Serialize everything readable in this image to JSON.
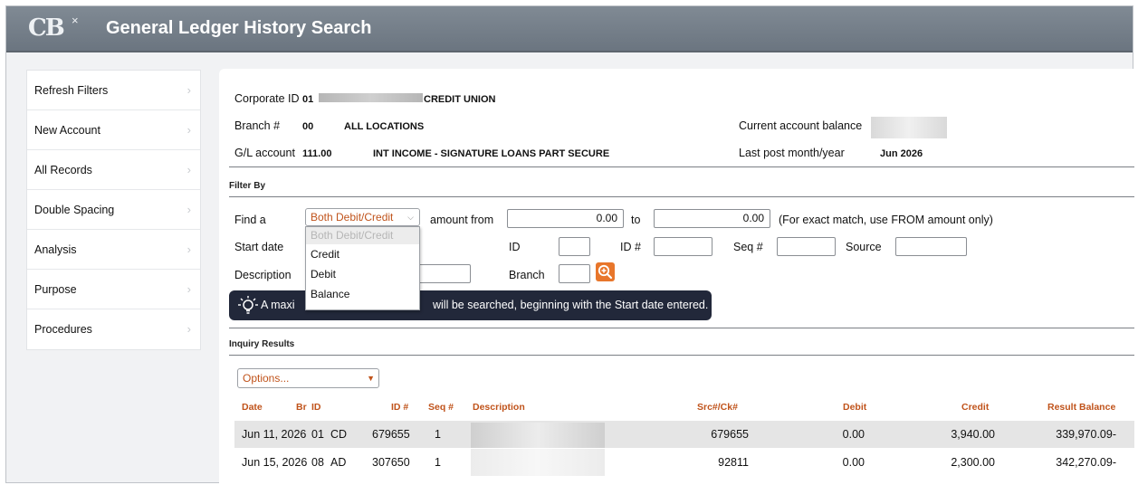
{
  "app": {
    "title": "General Ledger History Search",
    "logo_text": "CB",
    "logo_mark": "×"
  },
  "sidebar": {
    "items": [
      {
        "label": "Refresh Filters"
      },
      {
        "label": "New Account"
      },
      {
        "label": "All Records"
      },
      {
        "label": "Double Spacing"
      },
      {
        "label": "Analysis"
      },
      {
        "label": "Purpose"
      },
      {
        "label": "Procedures"
      }
    ]
  },
  "header": {
    "corporate_id_label": "Corporate ID",
    "corporate_id": "01",
    "corporate_name": "CREDIT UNION",
    "branch_label": "Branch #",
    "branch": "00",
    "branch_name": "ALL LOCATIONS",
    "gl_label": "G/L account",
    "gl_account": "111.00",
    "gl_name": "INT INCOME - SIGNATURE LOANS PART SECURE",
    "balance_label": "Current account balance",
    "last_post_label": "Last post month/year",
    "last_post": "Jun 2026"
  },
  "filter": {
    "section_label": "Filter By",
    "find_label": "Find a",
    "type_selected": "Both Debit/Credit",
    "type_options": [
      "Both Debit/Credit",
      "Credit",
      "Debit",
      "Balance"
    ],
    "amount_from_label": "amount from",
    "amount_from": "0.00",
    "to_label": "to",
    "amount_to": "0.00",
    "exact_note": "(For exact match, use FROM amount only)",
    "start_date_label": "Start date",
    "id_label": "ID",
    "id_num_label": "ID #",
    "seq_label": "Seq #",
    "source_label": "Source",
    "description_label": "Description",
    "branch_label": "Branch"
  },
  "tip": {
    "prefix": "A maxi",
    "text": "will be searched, beginning with the Start date entered."
  },
  "results": {
    "section_label": "Inquiry Results",
    "options_label": "Options...",
    "columns": [
      "Date",
      "Br",
      "ID",
      "ID #",
      "Seq #",
      "Description",
      "Src#/Ck#",
      "Debit",
      "Credit",
      "Result Balance"
    ],
    "rows": [
      {
        "date": "Jun 11, 2026",
        "br": "01",
        "id": "CD",
        "id_num": "679655",
        "seq": "1",
        "src": "679655",
        "debit": "0.00",
        "credit": "3,940.00",
        "balance": "339,970.09-"
      },
      {
        "date": "Jun 15, 2026",
        "br": "08",
        "id": "AD",
        "id_num": "307650",
        "seq": "1",
        "src": "92811",
        "debit": "0.00",
        "credit": "2,300.00",
        "balance": "342,270.09-"
      }
    ]
  },
  "colors": {
    "accent": "#c0531b",
    "search_button": "#e8762b",
    "titlebar": "#727c87",
    "tip_bg": "#22283a"
  },
  "icons": {
    "lightbulb": "lightbulb-icon",
    "search": "magnifier-plus-icon",
    "chevron": "chevron-right-icon",
    "caret": "caret-down-icon"
  }
}
